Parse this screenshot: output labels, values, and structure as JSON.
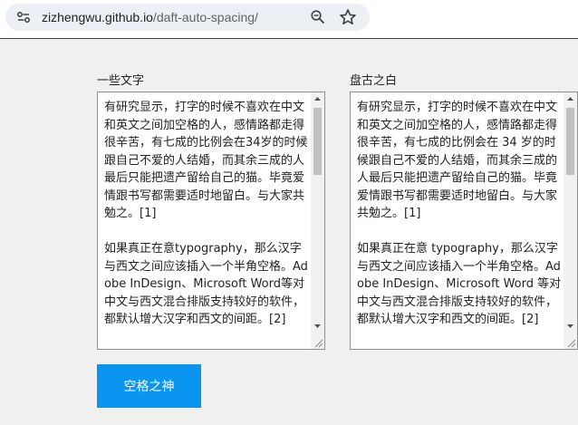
{
  "browser": {
    "url_host": "zizhengwu.github.io",
    "url_path": "/daft-auto-spacing/",
    "icons": [
      "site-info-icon",
      "zoom-icon",
      "star-icon"
    ]
  },
  "left_panel": {
    "label": "一些文字",
    "paragraphs": [
      "有研究显示，打字的时候不喜欢在中文和英文之间加空格的人，感情路都走得很辛苦，有七成的比例会在34岁的时候跟自己不爱的人结婚，而其余三成的人最后只能把遗产留给自己的猫。毕竟爱情跟书写都需要适时地留白。与大家共勉之。[1]",
      "如果真正在意typography，那么汉字与西文之间应该插入一个半角空格。Adobe InDesign、Microsoft Word等对中文与西文混合排版支持较好的软件，都默认增大汉字和西文的间距。[2]"
    ]
  },
  "right_panel": {
    "label": "盘古之白",
    "paragraphs": [
      "有研究显示，打字的时候不喜欢在中文和英文之间加空格的人，感情路都走得很辛苦，有七成的比例会在 34 岁的时候跟自己不爱的人结婚，而其余三成的人最后只能把遗产留给自己的猫。毕竟爱情跟书写都需要适时地留白。与大家共勉之。[1]",
      "如果真正在意 typography，那么汉字与西文之间应该插入一个半角空格。Adobe InDesign、Microsoft Word 等对中文与西文混合排版支持较好的软件，都默认增大汉字和西文的间距。[2]"
    ]
  },
  "button": {
    "label": "空格之神"
  },
  "colors": {
    "button_bg": "#0a95f0",
    "page_bg": "#f0f0f0"
  }
}
